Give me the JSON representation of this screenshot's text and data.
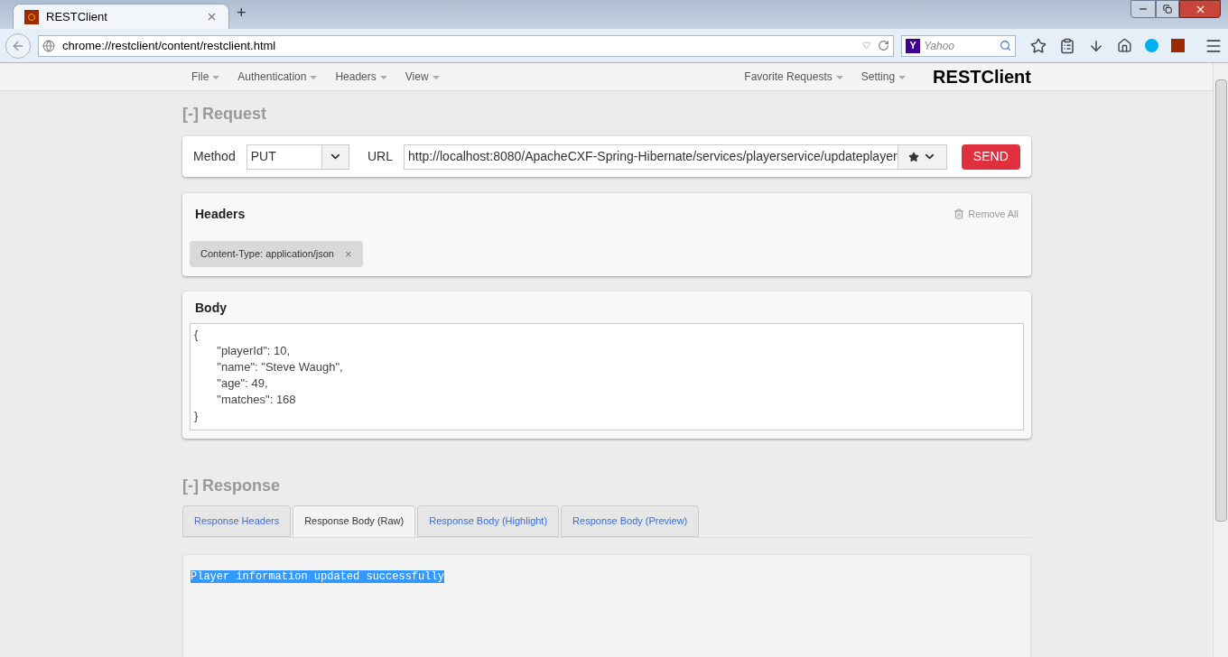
{
  "browser": {
    "tab_title": "RESTClient",
    "new_tab": "+",
    "address": "chrome://restclient/content/restclient.html",
    "search_placeholder": "Yahoo",
    "search_engine": "Y"
  },
  "app_menu": {
    "left": [
      "File",
      "Authentication",
      "Headers",
      "View"
    ],
    "right": [
      "Favorite Requests",
      "Setting"
    ],
    "brand": "RESTClient"
  },
  "request": {
    "toggle": "[-]",
    "title": "Request",
    "method_label": "Method",
    "method": "PUT",
    "url_label": "URL",
    "url": "http://localhost:8080/ApacheCXF-Spring-Hibernate/services/playerservice/updateplayer",
    "send": "SEND"
  },
  "headers": {
    "title": "Headers",
    "remove_all": "Remove All",
    "items": [
      {
        "text": "Content-Type: application/json",
        "remove": "×"
      }
    ]
  },
  "body": {
    "title": "Body",
    "text": "{\n\t\"playerId\": 10,\n\t\"name\": \"Steve Waugh\",\n\t\"age\": 49,\n\t\"matches\": 168\n}"
  },
  "response": {
    "toggle": "[-]",
    "title": "Response",
    "tabs": [
      {
        "label": "Response Headers",
        "selected": false
      },
      {
        "label": "Response Body (Raw)",
        "selected": true
      },
      {
        "label": "Response Body (Highlight)",
        "selected": false
      },
      {
        "label": "Response Body (Preview)",
        "selected": false
      }
    ],
    "output": "Player information updated successfully"
  }
}
